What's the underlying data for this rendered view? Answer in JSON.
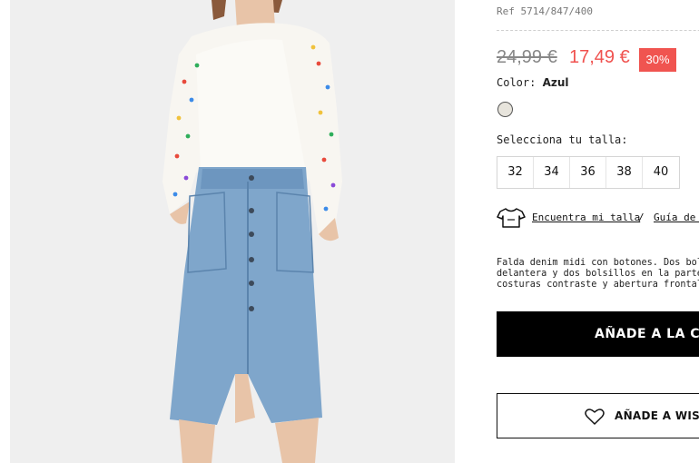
{
  "product": {
    "ref": "Ref 5714/847/400",
    "old_price": "24,99 €",
    "new_price": "17,49 €",
    "discount": "30%",
    "color_label": "Color:",
    "color_value": "Azul",
    "swatch_color": "#e7e4dc",
    "size_label": "Selecciona tu talla:",
    "sizes": [
      "32",
      "34",
      "36",
      "38",
      "40"
    ],
    "fit_link": "Encuentra mi talla",
    "separator": "/",
    "guide_link": "Guía de t",
    "description_lines": [
      "Falda denim midi con botones. Dos bolsi",
      "delantera y dos bolsillos en la parte tra",
      "costuras contraste y abertura frontal."
    ],
    "add_to_cart": "AÑADE A LA CES",
    "add_to_wishlist": "AÑADE A WISH"
  },
  "colors": {
    "sale": "#f0524f",
    "discount_bg": "#f05450",
    "cta_bg": "#000000"
  },
  "icons": [
    "tshirt-icon",
    "heart-icon"
  ]
}
